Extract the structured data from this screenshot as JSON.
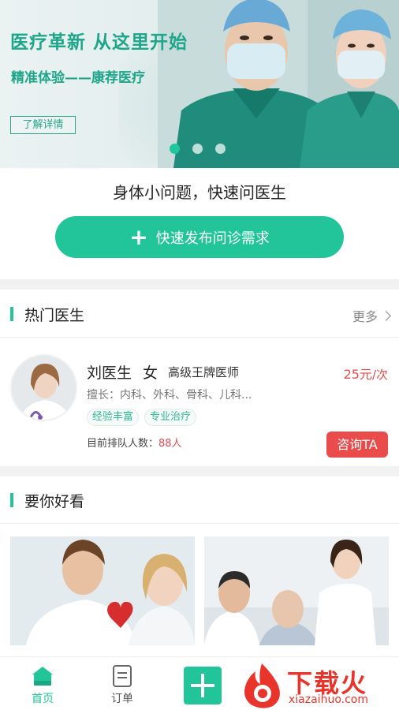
{
  "banner": {
    "title": "医疗革新  从这里开始",
    "subtitle": "精准体验——康荐医疗",
    "button_label": "了解详情",
    "dots_total": 3,
    "dots_active_index": 0
  },
  "quick": {
    "heading": "身体小问题，快速问医生",
    "button_label": "快速发布问诊需求"
  },
  "hot_doctors": {
    "title": "热门医生",
    "more_label": "更多",
    "doctor": {
      "name": "刘医生",
      "gender": "女",
      "rank": "高级王牌医师",
      "price": "25元",
      "price_unit": "/次",
      "specialty": "擅长：内科、外科、骨科、儿科...",
      "tags": [
        "经验丰富",
        "专业治疗"
      ],
      "queue_label": "目前排队人数：",
      "queue_count": "88人",
      "consult_label": "咨询TA"
    }
  },
  "recommend": {
    "title": "要你好看"
  },
  "tabbar": {
    "home_label": "首页",
    "order_label": "订单"
  },
  "watermark": {
    "text": "下载火",
    "sub": "xiazaihuo.com"
  },
  "colors": {
    "accent": "#22c59a",
    "banner_text": "#1ea68a",
    "price_red": "#e54b4b",
    "consult_red": "#ea4c4c"
  }
}
